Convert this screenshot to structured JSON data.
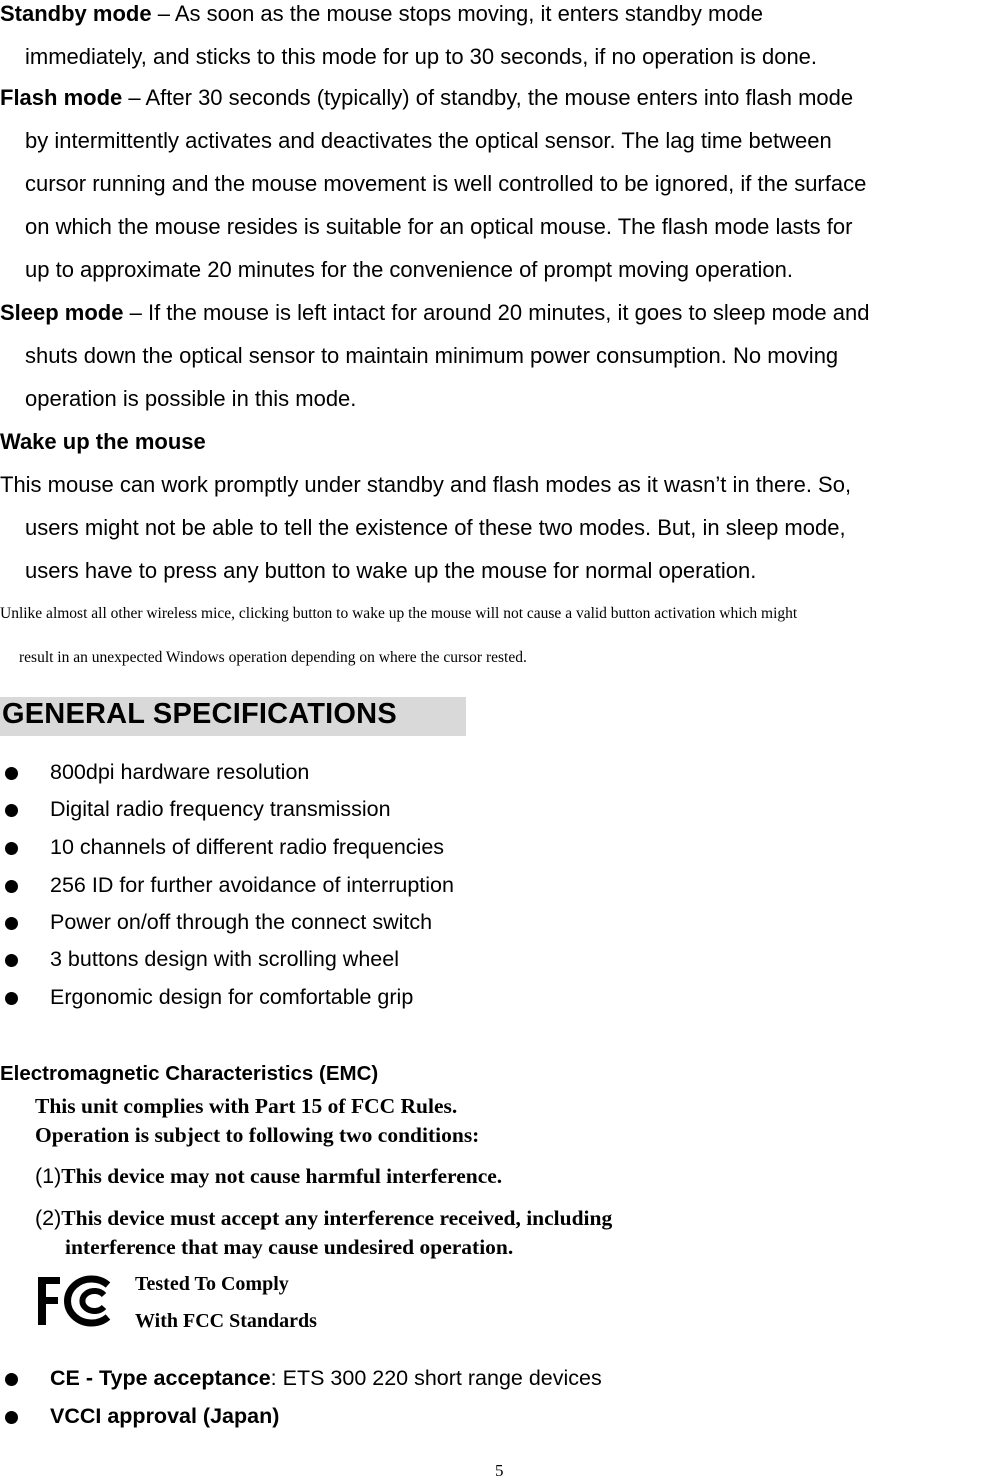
{
  "modes": [
    {
      "title": "Standby mode",
      "separator": " – ",
      "line1": "As soon as the mouse stops moving, it enters standby mode",
      "continuation": [
        "immediately, and sticks to this mode for up to 30 seconds, if no operation is done."
      ]
    },
    {
      "title": "Flash mode",
      "separator": " – ",
      "line1": "After 30 seconds (typically) of standby, the mouse enters into flash mode",
      "continuation": [
        "by intermittently activates and deactivates the optical sensor. The lag time between",
        "cursor running and the mouse movement is well controlled to be ignored, if the surface",
        "on which the mouse resides is suitable for an optical mouse. The flash mode lasts for",
        "up to approximate 20 minutes for the convenience of prompt moving operation."
      ]
    },
    {
      "title": "Sleep mode",
      "separator": " – ",
      "line1": "If the mouse is left intact for around 20 minutes, it goes to sleep mode and",
      "continuation": [
        "shuts down the optical sensor to maintain minimum power consumption. No moving",
        "operation is possible in this mode."
      ]
    }
  ],
  "wake": {
    "heading": "Wake up the mouse",
    "lines": [
      "This mouse can work promptly under standby and flash modes as it wasn’t in there. So,",
      "users might not be able to tell the existence of these two modes. But, in sleep mode,",
      "users have to press any button to wake up the mouse for normal operation."
    ],
    "note_lines": [
      "Unlike almost all other wireless mice, clicking button to wake up the mouse will not cause a valid button activation which might",
      "result in an unexpected Windows operation depending on where the cursor rested."
    ]
  },
  "specs": {
    "heading": "GENERAL SPECIFICATIONS",
    "items": [
      "800dpi hardware resolution",
      "Digital radio frequency transmission",
      "10 channels of different radio frequencies",
      "256 ID for further avoidance of interruption",
      "Power on/off through the connect switch",
      "3 buttons design with scrolling wheel",
      "Ergonomic design for comfortable grip"
    ]
  },
  "emc": {
    "heading": "Electromagnetic Characteristics (EMC)",
    "line1": "This unit complies with Part 15 of FCC Rules.",
    "line2": "Operation is subject to following two conditions:",
    "conditions": [
      {
        "num": "(1)",
        "lines": [
          "This device may not cause harmful interference."
        ]
      },
      {
        "num": "(2)",
        "lines": [
          "This device must accept any interference received, including",
          "interference that may cause undesired operation."
        ]
      }
    ],
    "fcc_logo": "fcc-logo",
    "fcc_line1": "Tested To Comply",
    "fcc_line2": "With FCC Standards"
  },
  "approvals": [
    {
      "bold": "CE - Type acceptance",
      "rest": ": ETS 300 220 short range devices"
    },
    {
      "bold": "VCCI approval (Japan)",
      "rest": ""
    }
  ],
  "page_number": "5"
}
